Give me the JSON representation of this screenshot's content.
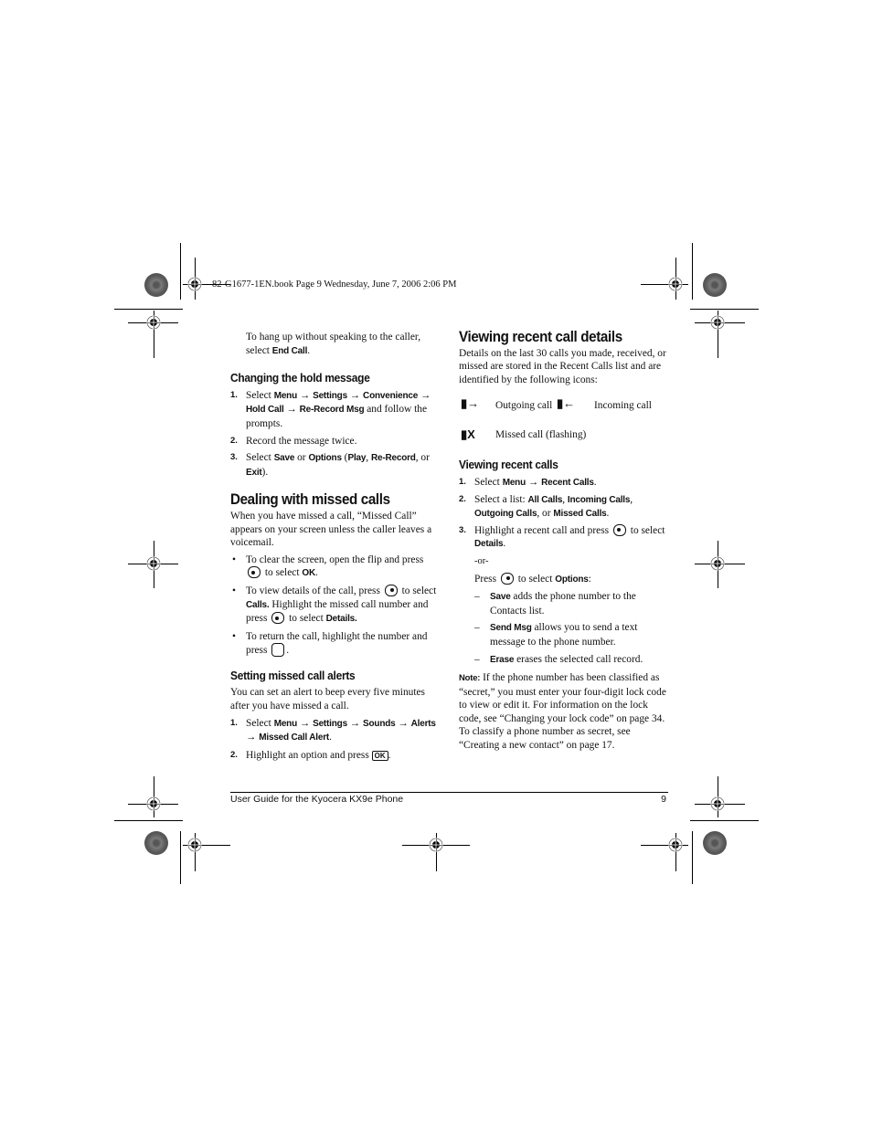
{
  "header": {
    "book_meta": "82-G1677-1EN.book  Page 9  Wednesday, June 7, 2006  2:06 PM"
  },
  "left_column": {
    "intro": {
      "text": "To hang up without speaking to the caller, select ",
      "bold": "End Call",
      "end": "."
    },
    "hold_message": {
      "heading": "Changing the hold message",
      "steps": [
        {
          "num": "1.",
          "parts": [
            "Select ",
            "Menu",
            " → ",
            "Settings",
            " → ",
            "Convenience",
            " → ",
            "Hold Call",
            " → ",
            "Re-Record Msg",
            " and follow the prompts."
          ]
        },
        {
          "num": "2.",
          "text": "Record the message twice."
        },
        {
          "num": "3.",
          "parts": [
            "Select ",
            "Save",
            " or ",
            "Options",
            " (",
            "Play",
            ", ",
            "Re-Record",
            ", or ",
            "Exit",
            ")."
          ]
        }
      ]
    },
    "missed_calls": {
      "heading": "Dealing with missed calls",
      "intro": "When you have missed a call, “Missed Call” appears on your screen unless the caller leaves a voicemail.",
      "bullets": [
        {
          "a": "To clear the screen, open the flip and press",
          "b": "to select ",
          "bold": "OK",
          "end": ".",
          "key": "left-softkey-icon"
        },
        {
          "a": "To view details of the call, press",
          "b": "to select",
          "bold1": "Calls.",
          "c": " Highlight the missed call number and press",
          "d": "to select ",
          "bold2": "Details.",
          "key1": "right-softkey-icon",
          "key2": "left-softkey-icon"
        },
        {
          "a": "To return the call, highlight the number and press",
          "end": ".",
          "key": "send-key-icon"
        }
      ]
    },
    "alerts": {
      "heading": "Setting missed call alerts",
      "intro": "You can set an alert to beep every five minutes after you have missed a call.",
      "steps": [
        {
          "num": "1.",
          "parts": [
            "Select ",
            "Menu",
            " → ",
            "Settings",
            " → ",
            "Sounds",
            " → ",
            "Alerts",
            " → ",
            "Missed Call Alert",
            "."
          ]
        },
        {
          "num": "2.",
          "text": "Highlight an option and press",
          "key_label": "OK",
          "end": "."
        }
      ]
    }
  },
  "right_column": {
    "recent_details": {
      "heading": "Viewing recent call details",
      "intro": "Details on the last 30 calls you made, received, or missed are stored in the Recent Calls list and are identified by the following icons:",
      "icons": [
        {
          "icon": "outgoing-call-icon",
          "label": "Outgoing call"
        },
        {
          "icon": "incoming-call-icon",
          "label": "Incoming call"
        },
        {
          "icon": "missed-call-icon",
          "label": "Missed call (flashing)"
        }
      ]
    },
    "recent_calls": {
      "heading": "Viewing recent calls",
      "steps": [
        {
          "num": "1.",
          "parts": [
            "Select ",
            "Menu",
            " → ",
            "Recent Calls",
            "."
          ]
        },
        {
          "num": "2.",
          "parts": [
            "Select a list: ",
            "All Calls",
            ", ",
            "Incoming Calls",
            ", ",
            "Outgoing Calls",
            ", or ",
            "Missed Calls",
            "."
          ]
        },
        {
          "num": "3.",
          "a": "Highlight a recent call and press",
          "b": " to select ",
          "bold": "Details",
          "end": "."
        }
      ],
      "or": "-or-",
      "press": {
        "a": "Press",
        "b": " to select ",
        "bold": "Options",
        "end": ":"
      },
      "options": [
        {
          "bold": "Save",
          "text": " adds the phone number to the Contacts list."
        },
        {
          "bold": "Send Msg",
          "text": " allows you to send a text message to the phone number."
        },
        {
          "bold": "Erase",
          "text": " erases the selected call record."
        }
      ],
      "note": {
        "label": "Note:",
        "text": "  If the phone number has been classified as “secret,” you must enter your four-digit lock code to view or edit it. For information on the lock code, see “Changing your lock code” on page 34. To classify a phone number as secret, see “Creating a new contact” on page 17."
      }
    }
  },
  "footer": {
    "title": "User Guide for the Kyocera KX9e Phone",
    "page_number": "9"
  }
}
